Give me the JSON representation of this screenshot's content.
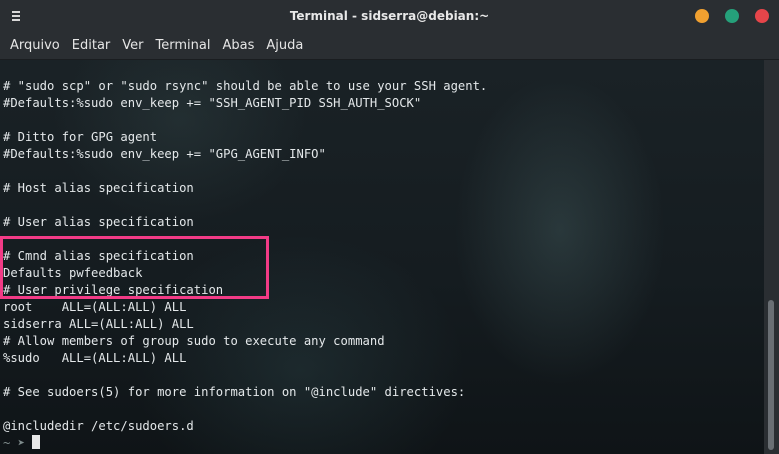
{
  "window": {
    "title": "Terminal - sidserra@debian:~",
    "buttons": [
      {
        "name": "minimize",
        "color": "#f0a030"
      },
      {
        "name": "maximize",
        "color": "#25a07a"
      },
      {
        "name": "close",
        "color": "#e6454a"
      }
    ]
  },
  "menu": [
    "Arquivo",
    "Editar",
    "Ver",
    "Terminal",
    "Abas",
    "Ajuda"
  ],
  "terminal": {
    "lines": [
      "# \"sudo scp\" or \"sudo rsync\" should be able to use your SSH agent.",
      "#Defaults:%sudo env_keep += \"SSH_AGENT_PID SSH_AUTH_SOCK\"",
      "",
      "# Ditto for GPG agent",
      "#Defaults:%sudo env_keep += \"GPG_AGENT_INFO\"",
      "",
      "# Host alias specification",
      "",
      "# User alias specification",
      "",
      "# Cmnd alias specification",
      "Defaults pwfeedback",
      "# User privilege specification",
      "root    ALL=(ALL:ALL) ALL",
      "sidserra ALL=(ALL:ALL) ALL",
      "# Allow members of group sudo to execute any command",
      "%sudo   ALL=(ALL:ALL) ALL",
      "",
      "# See sudoers(5) for more information on \"@include\" directives:",
      "",
      "@includedir /etc/sudoers.d"
    ],
    "prompt": "~ ➤ ",
    "highlight_color": "#f23b86"
  }
}
